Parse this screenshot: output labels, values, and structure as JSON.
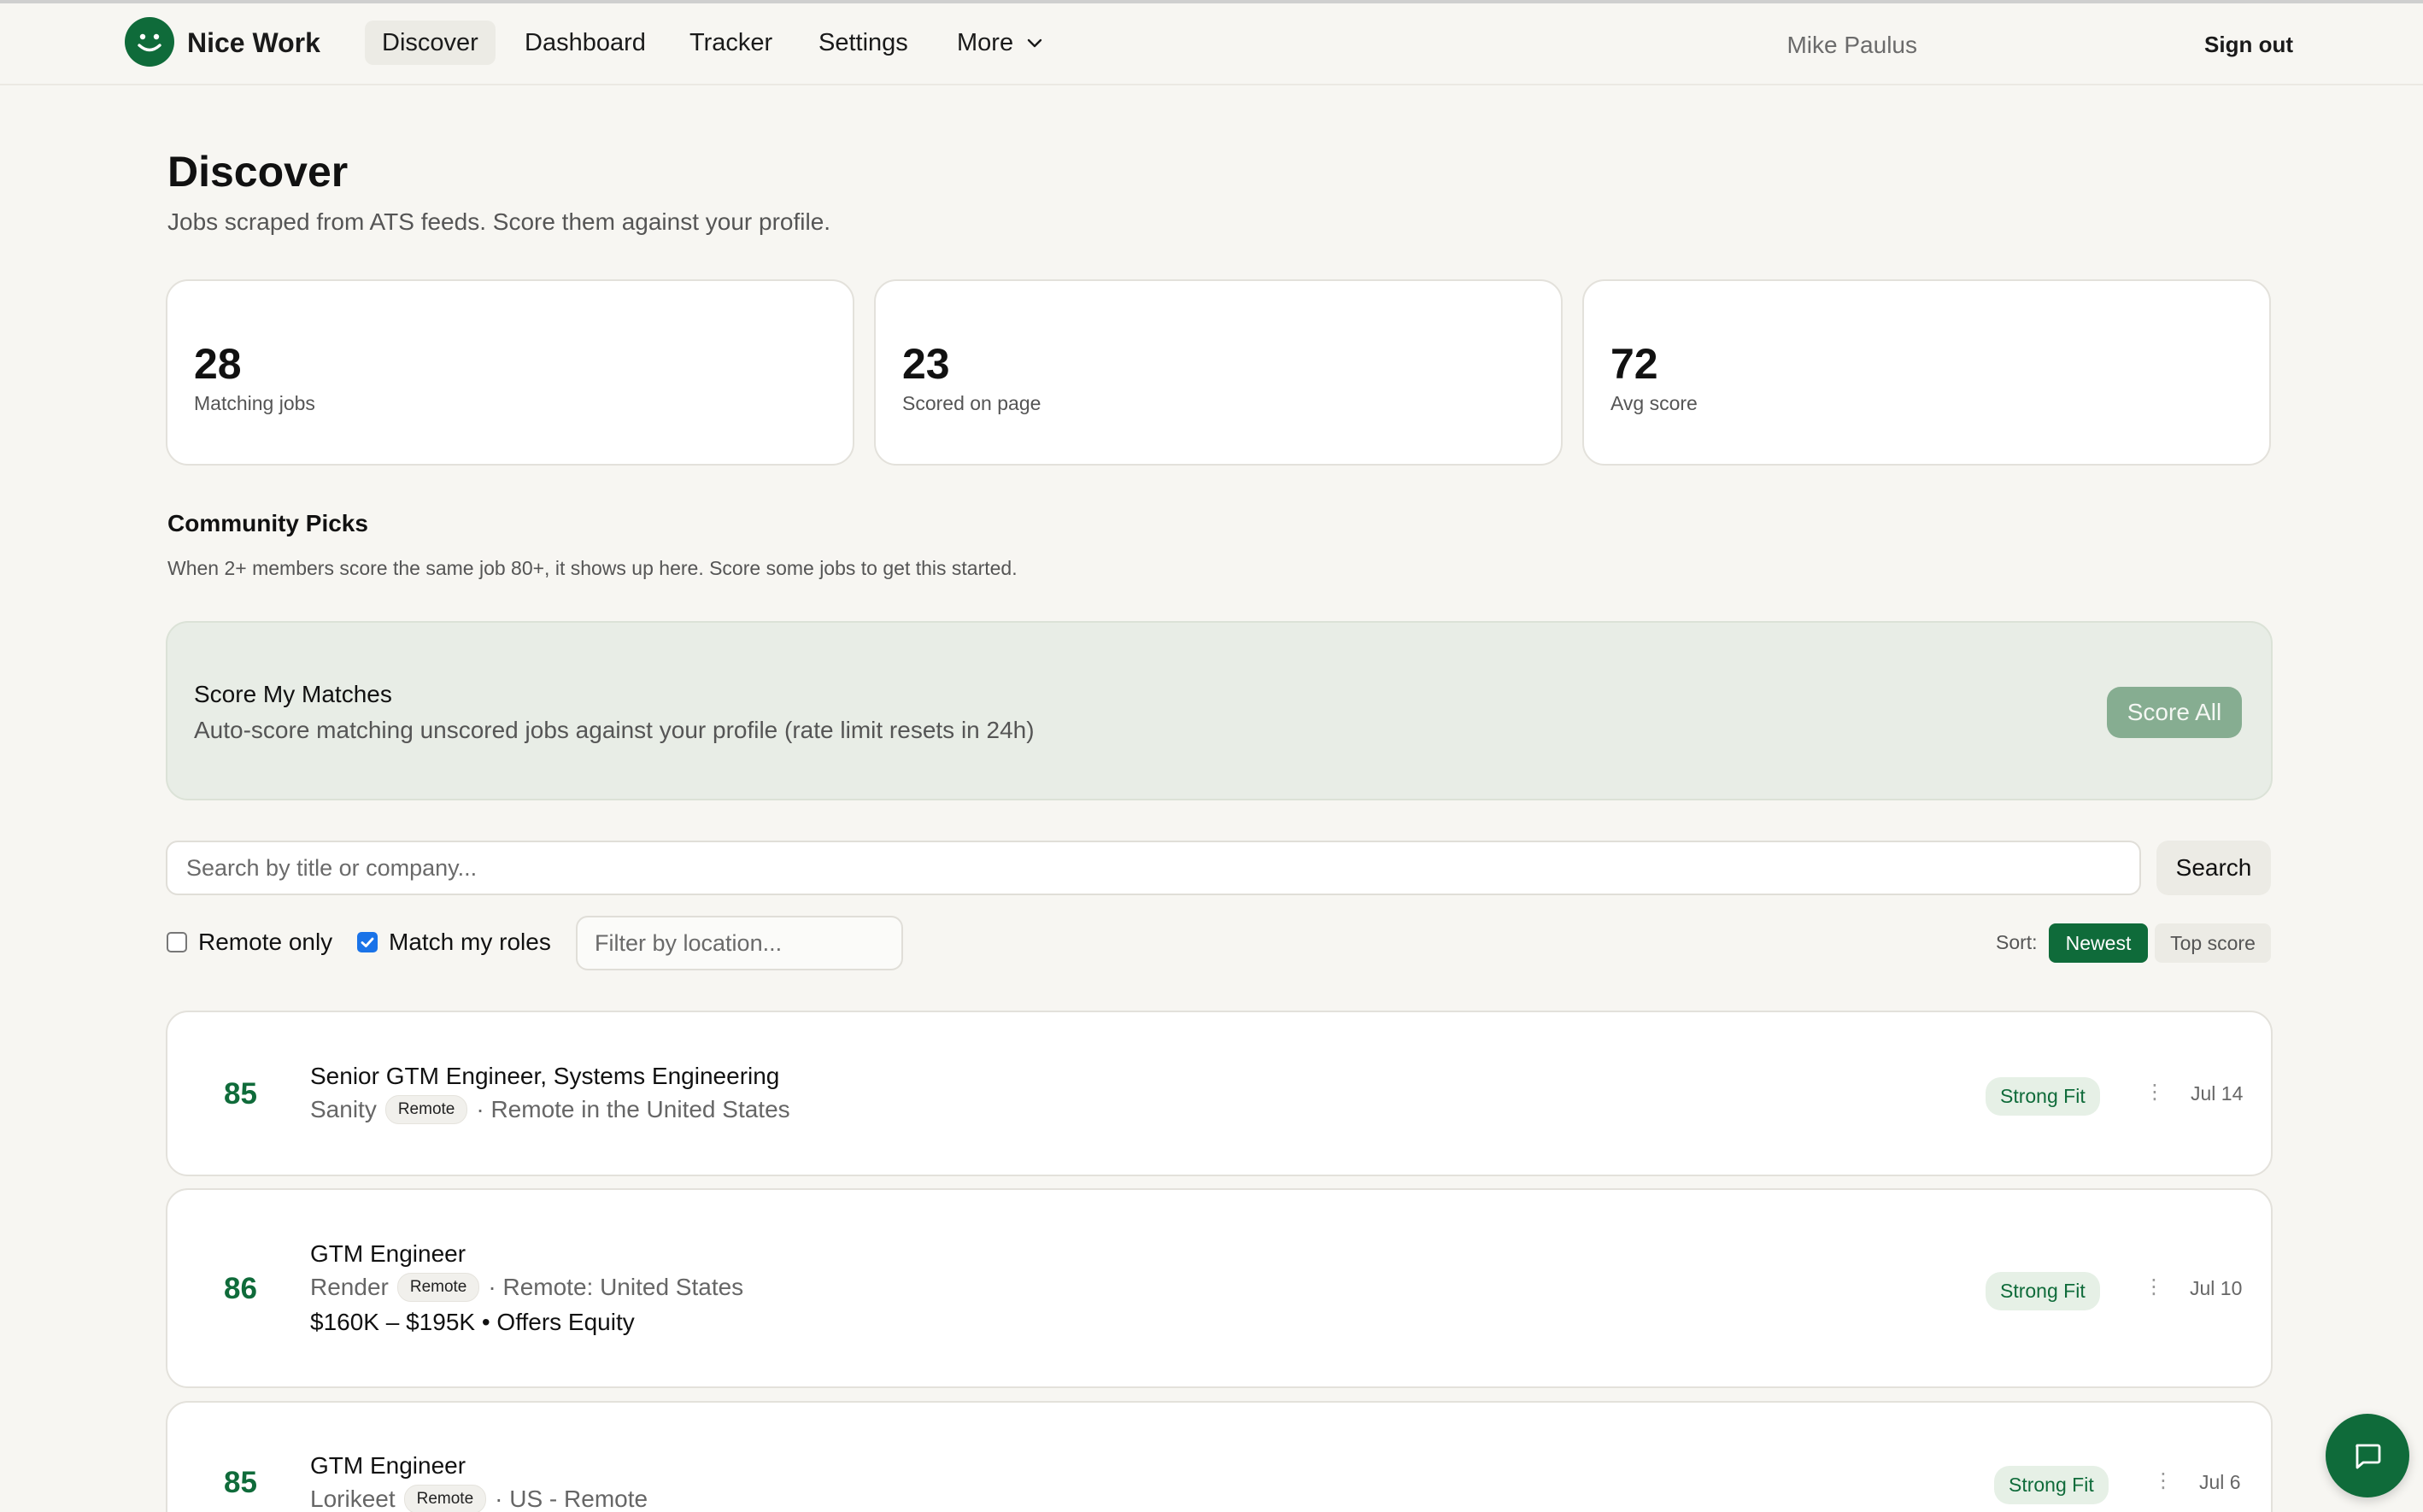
{
  "app": {
    "name": "Nice Work"
  },
  "nav": {
    "items": [
      {
        "label": "Discover",
        "active": true
      },
      {
        "label": "Dashboard"
      },
      {
        "label": "Tracker"
      },
      {
        "label": "Settings"
      },
      {
        "label": "More"
      }
    ],
    "user_name": "Mike Paulus",
    "sign_out": "Sign out"
  },
  "page": {
    "title": "Discover",
    "subtitle": "Jobs scraped from ATS feeds. Score them against your profile."
  },
  "stats": [
    {
      "value": "28",
      "label": "Matching jobs"
    },
    {
      "value": "23",
      "label": "Scored on page"
    },
    {
      "value": "72",
      "label": "Avg score"
    }
  ],
  "community": {
    "title": "Community Picks",
    "description": "When 2+ members score the same job 80+, it shows up here. Score some jobs to get this started."
  },
  "score_banner": {
    "title": "Score My Matches",
    "description": "Auto-score matching unscored jobs against your profile (rate limit resets in 24h)",
    "button": "Score All"
  },
  "search": {
    "placeholder": "Search by title or company...",
    "button": "Search"
  },
  "filters": {
    "remote_only": {
      "label": "Remote only",
      "checked": false
    },
    "match_roles": {
      "label": "Match my roles",
      "checked": true
    },
    "location_placeholder": "Filter by location..."
  },
  "sort": {
    "label": "Sort:",
    "options": [
      "Newest",
      "Top score"
    ],
    "selected": "Newest"
  },
  "jobs": [
    {
      "score": "85",
      "title": "Senior GTM Engineer, Systems Engineering",
      "company": "Sanity",
      "tag": "Remote",
      "location": "· Remote in the United States",
      "fit": "Strong Fit",
      "date": "Jul 14"
    },
    {
      "score": "86",
      "title": "GTM Engineer",
      "company": "Render",
      "tag": "Remote",
      "location": "· Remote: United States",
      "salary": "$160K – $195K • Offers Equity",
      "fit": "Strong Fit",
      "date": "Jul 10"
    },
    {
      "score": "85",
      "title": "GTM Engineer",
      "company": "Lorikeet",
      "tag": "Remote",
      "location": "· US - Remote",
      "fit": "Strong Fit",
      "date": "Jul 6"
    }
  ],
  "colors": {
    "brand": "#0f6b3a",
    "background": "#f7f6f2",
    "banner": "#e8ede6",
    "score_all_button": "#86ad91",
    "fit_badge_bg": "#e6f0e6"
  },
  "icons": {
    "logo": "smiley-logo-icon",
    "more": "chevron-down-icon",
    "kebab": "kebab-menu-icon",
    "chat": "chat-bubble-icon",
    "check": "checkmark-icon"
  }
}
